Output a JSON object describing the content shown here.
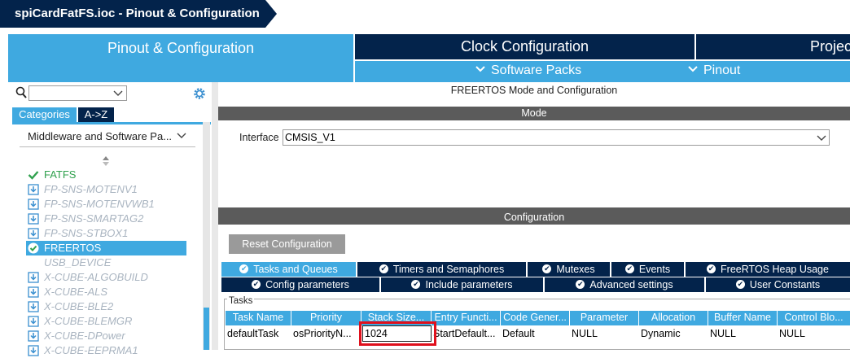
{
  "window": {
    "title": "spiCardFatFS.ioc - Pinout & Configuration"
  },
  "main_tabs": [
    {
      "label": "Pinout & Configuration"
    },
    {
      "label": "Clock Configuration"
    },
    {
      "label": "Projec"
    }
  ],
  "sub_menu": {
    "software_packs": "Software Packs",
    "pinout": "Pinout"
  },
  "sidebar": {
    "search_value": "",
    "tab_categories": "Categories",
    "tab_az": "A->Z",
    "group_label": "Middleware and Software Pa...",
    "items": [
      {
        "label": "FATFS",
        "icon": "check-icon"
      },
      {
        "label": "FP-SNS-MOTENV1",
        "icon": "download-icon"
      },
      {
        "label": "FP-SNS-MOTENVWB1",
        "icon": "download-icon"
      },
      {
        "label": "FP-SNS-SMARTAG2",
        "icon": "download-icon"
      },
      {
        "label": "FP-SNS-STBOX1",
        "icon": "download-icon"
      },
      {
        "label": "FREERTOS",
        "icon": "check-circle-icon"
      },
      {
        "label": "USB_DEVICE",
        "icon": ""
      },
      {
        "label": "X-CUBE-ALGOBUILD",
        "icon": "download-icon"
      },
      {
        "label": "X-CUBE-ALS",
        "icon": "download-icon"
      },
      {
        "label": "X-CUBE-BLE2",
        "icon": "download-icon"
      },
      {
        "label": "X-CUBE-BLEMGR",
        "icon": "download-icon"
      },
      {
        "label": "X-CUBE-DPower",
        "icon": "download-icon"
      },
      {
        "label": "X-CUBE-EEPRMA1",
        "icon": "download-icon"
      }
    ]
  },
  "panel": {
    "title": "FREERTOS Mode and Configuration",
    "mode_header": "Mode",
    "interface_label": "Interface",
    "interface_value": "CMSIS_V1",
    "config_header": "Configuration",
    "reset_button": "Reset Configuration",
    "tabs_row1": [
      "Tasks and Queues",
      "Timers and Semaphores",
      "Mutexes",
      "Events",
      "FreeRTOS Heap Usage"
    ],
    "tabs_row2": [
      "Config parameters",
      "Include parameters",
      "Advanced settings",
      "User Constants"
    ],
    "tasks_group": "Tasks",
    "table": {
      "headers": [
        "Task Name",
        "Priority",
        "Stack Size...",
        "Entry Functi...",
        "Code Gener...",
        "Parameter",
        "Allocation",
        "Buffer Name",
        "Control Blo..."
      ],
      "rows": [
        [
          "defaultTask",
          "osPriorityN...",
          "1024",
          "StartDefault...",
          "Default",
          "NULL",
          "Dynamic",
          "NULL",
          "NULL"
        ]
      ]
    }
  },
  "colors": {
    "navy": "#03234b",
    "accent": "#3fa9e0",
    "highlight": "#e0101c",
    "ok": "#30a14e"
  }
}
